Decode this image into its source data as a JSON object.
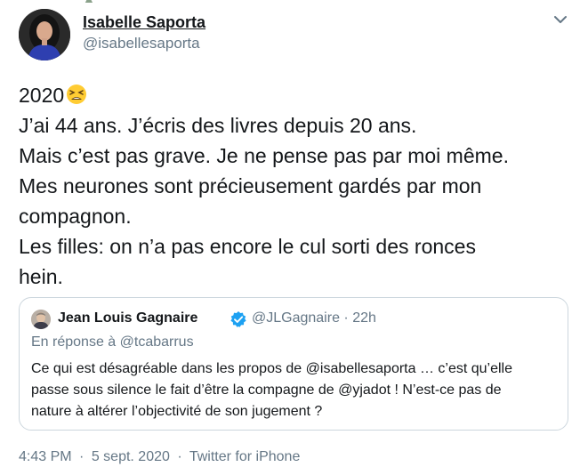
{
  "author": {
    "name": "Isabelle Saporta",
    "handle": "@isabellesaporta"
  },
  "tweet": {
    "lines": [
      "2020",
      "J’ai 44 ans. J’écris des livres depuis 20 ans.",
      "Mais c’est pas grave. Je ne pense pas par moi même.",
      "Mes neurones sont précieusement gardés par mon",
      "compagnon.",
      "Les filles: on n’a pas encore le cul sorti des ronces",
      "hein."
    ],
    "emoji": "tired-face-emoji"
  },
  "quoted": {
    "name": "Jean Louis Gagnaire",
    "verified": true,
    "handle": "@JLGagnaire",
    "dot": "·",
    "age": "22h",
    "reply_to": "En réponse à @tcabarrus",
    "lines": [
      "Ce qui est désagréable dans les propos de @isabellesaporta … c’est qu’elle",
      "passe sous silence le fait d’être la compagne de @yjadot ! N’est-ce pas de",
      "nature à altérer l’objectivité de son jugement ?"
    ]
  },
  "footer": {
    "time": "4:43 PM",
    "dot1": "·",
    "date": "5 sept. 2020",
    "dot2": "·",
    "source": "Twitter for iPhone"
  },
  "colors": {
    "text": "#14171a",
    "muted": "#657786",
    "border": "#ccd6dd",
    "verified": "#1da1f2"
  },
  "icons": {
    "more": "chevron-down-icon",
    "verified": "verified-badge-icon"
  }
}
